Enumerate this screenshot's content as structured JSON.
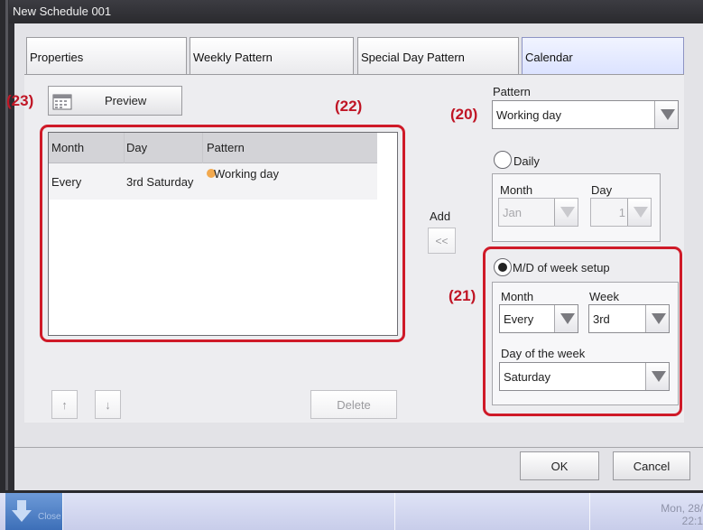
{
  "window": {
    "title": "New Schedule 001"
  },
  "tabs": [
    {
      "label": "Properties"
    },
    {
      "label": "Weekly Pattern"
    },
    {
      "label": "Special Day Pattern"
    },
    {
      "label": "Calendar"
    }
  ],
  "callouts": {
    "preview": "(23)",
    "table": "(22)",
    "pattern": "(20)",
    "week_setup": "(21)"
  },
  "toolbar": {
    "preview_label": "Preview"
  },
  "table": {
    "columns": [
      "Month",
      "Day",
      "Pattern"
    ],
    "rows": [
      {
        "month": "Every",
        "day": "3rd Saturday",
        "pattern": "Working day"
      }
    ]
  },
  "list_buttons": {
    "up": "↑",
    "down": "↓",
    "delete": "Delete"
  },
  "add": {
    "label": "Add",
    "button": "<<"
  },
  "pattern": {
    "label": "Pattern",
    "value": "Working day"
  },
  "daily": {
    "label": "Daily",
    "month_label": "Month",
    "month_value": "Jan",
    "day_label": "Day",
    "day_value": "1"
  },
  "week_setup": {
    "label": "M/D of week setup",
    "month_label": "Month",
    "month_value": "Every",
    "week_label": "Week",
    "week_value": "3rd",
    "dow_label": "Day of the week",
    "dow_value": "Saturday"
  },
  "footer": {
    "ok": "OK",
    "cancel": "Cancel"
  },
  "taskbar": {
    "start": "Close",
    "date": "Mon, 28/",
    "time": "22:1"
  },
  "colors": {
    "callout_red": "#cf1a28",
    "active_tab": "#dbe2ff",
    "pattern_dot": "#f2a94e"
  }
}
